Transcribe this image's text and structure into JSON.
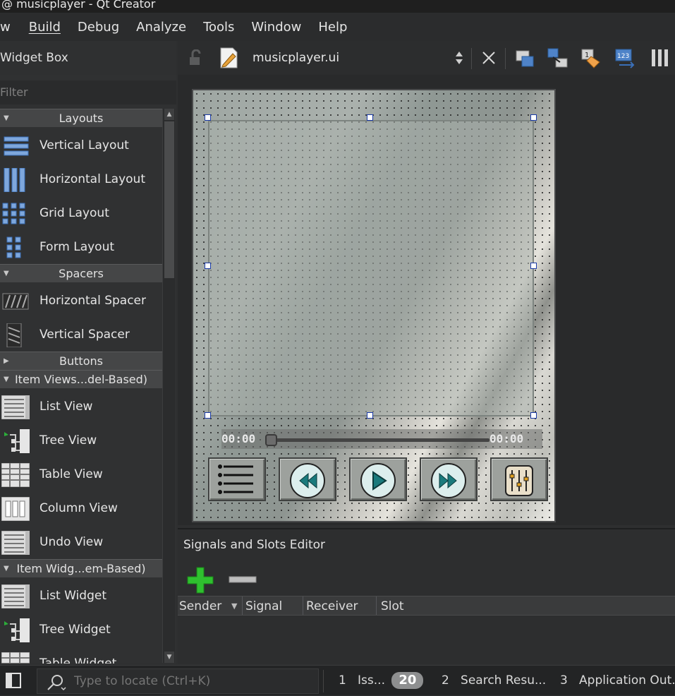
{
  "window": {
    "title": "@ musicplayer - Qt Creator"
  },
  "menubar": [
    "w",
    "Build",
    "Debug",
    "Analyze",
    "Tools",
    "Window",
    "Help"
  ],
  "widget_box": {
    "title": "Widget Box",
    "filter_placeholder": "Filter",
    "categories": {
      "layouts": "Layouts",
      "spacers": "Spacers",
      "buttons": "Buttons",
      "item_views": "Item Views...del-Based)",
      "item_widgets": "Item Widg...em-Based)"
    },
    "items": {
      "vertical_layout": "Vertical Layout",
      "horizontal_layout": "Horizontal Layout",
      "grid_layout": "Grid Layout",
      "form_layout": "Form Layout",
      "horizontal_spacer": "Horizontal Spacer",
      "vertical_spacer": "Vertical Spacer",
      "list_view": "List View",
      "tree_view": "Tree View",
      "table_view": "Table View",
      "column_view": "Column View",
      "undo_view": "Undo View",
      "list_widget": "List Widget",
      "tree_widget": "Tree Widget",
      "table_widget": "Table Widget"
    }
  },
  "editor": {
    "document_name": "musicplayer.ui",
    "form": {
      "time_elapsed": "00:00",
      "time_total": "00:00",
      "controls": [
        "playlist-icon",
        "previous-icon",
        "play-icon",
        "next-icon",
        "equalizer-icon"
      ]
    }
  },
  "signals_slots": {
    "title": "Signals and Slots Editor",
    "columns": [
      "Sender",
      "Signal",
      "Receiver",
      "Slot"
    ]
  },
  "statusbar": {
    "locator_placeholder": "Type to locate (Ctrl+K)",
    "panes": [
      {
        "num": "1",
        "label": "Iss...",
        "badge": "20"
      },
      {
        "num": "2",
        "label": "Search Resu..."
      },
      {
        "num": "3",
        "label": "Application Out..."
      }
    ]
  },
  "colors": {
    "selection_handle": "#1a3aa8",
    "add_green": "#2fc02f"
  }
}
